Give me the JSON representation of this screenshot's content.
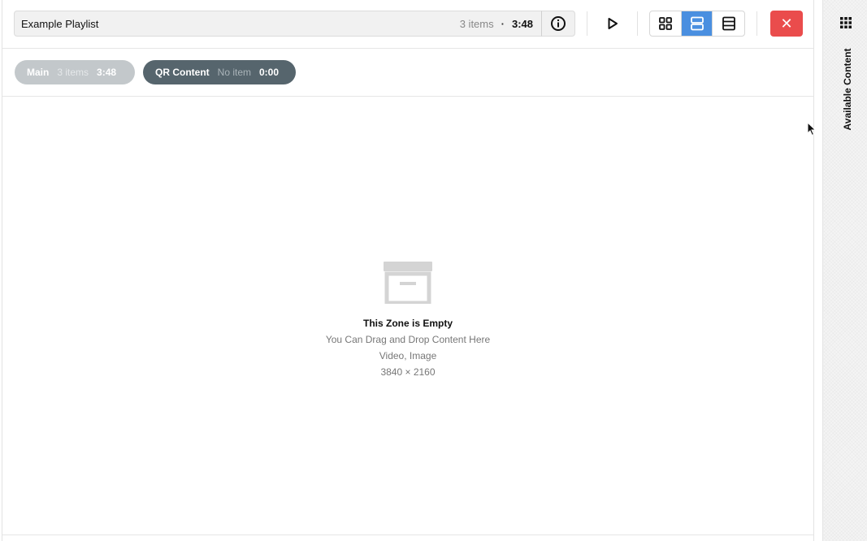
{
  "toolbar": {
    "playlist_name": "Example Playlist",
    "item_count": "3 items",
    "separator": "·",
    "duration": "3:48",
    "icons": {
      "info": "info-circle-icon",
      "play": "play-icon",
      "view_grid": "grid-view-icon",
      "view_split": "split-view-icon",
      "view_list": "list-view-icon",
      "close": "close-icon"
    },
    "active_view": "split",
    "close_label": "✕"
  },
  "zones": [
    {
      "name": "Main",
      "count": "3 items",
      "duration": "3:48",
      "selected": false
    },
    {
      "name": "QR Content",
      "count": "No item",
      "duration": "0:00",
      "selected": true
    }
  ],
  "empty_state": {
    "icon": "archive-box-icon",
    "title": "This Zone is Empty",
    "hint": "You Can Drag and Drop Content Here",
    "types": "Video, Image",
    "resolution": "3840 × 2160"
  },
  "sidebar": {
    "icon": "apps-grid-icon",
    "label": "Available Content"
  },
  "colors": {
    "accent": "#4a8fe0",
    "danger": "#ea4c4c",
    "zone_selected": "#56656d",
    "zone_unselected": "#c3c8cb"
  }
}
